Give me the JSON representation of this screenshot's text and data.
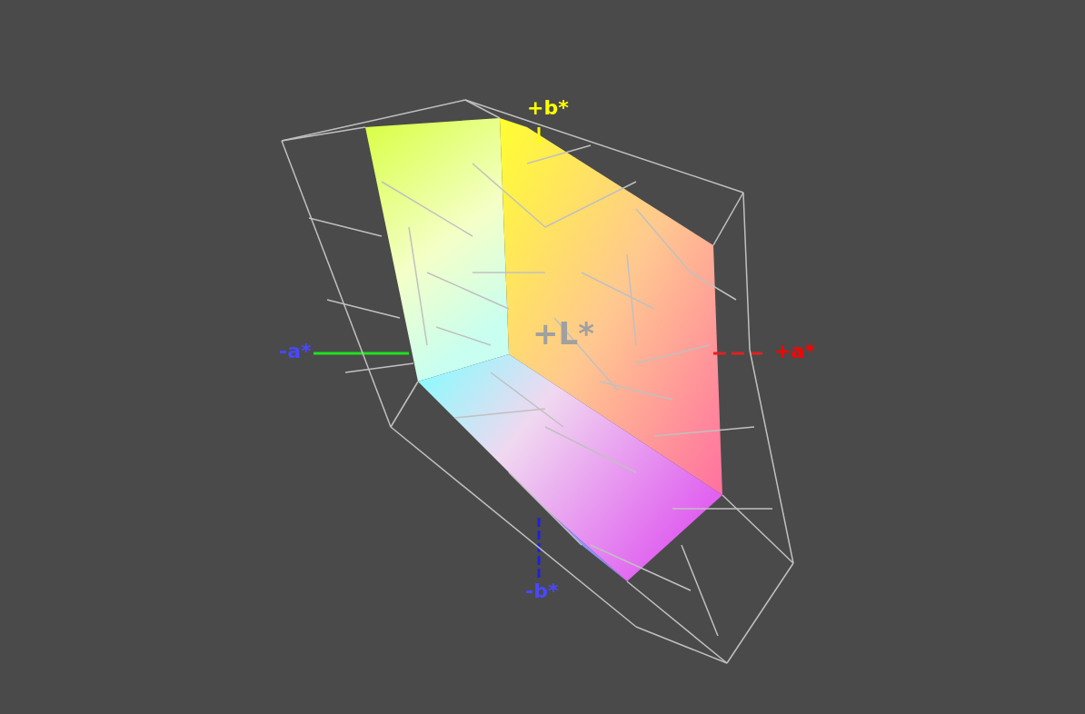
{
  "axis_labels": [
    {
      "kind": "b_plus",
      "label": "+b*",
      "color": "#ffff00"
    },
    {
      "kind": "l_plus",
      "label": "+L*",
      "color": "#a0a0a0"
    },
    {
      "kind": "a_minus",
      "label": "-a*",
      "color": "#4848ff"
    },
    {
      "kind": "a_plus",
      "label": "+a*",
      "color": "#ff0000"
    },
    {
      "kind": "b_minus",
      "label": "-b*",
      "color": "#4848ff"
    }
  ]
}
